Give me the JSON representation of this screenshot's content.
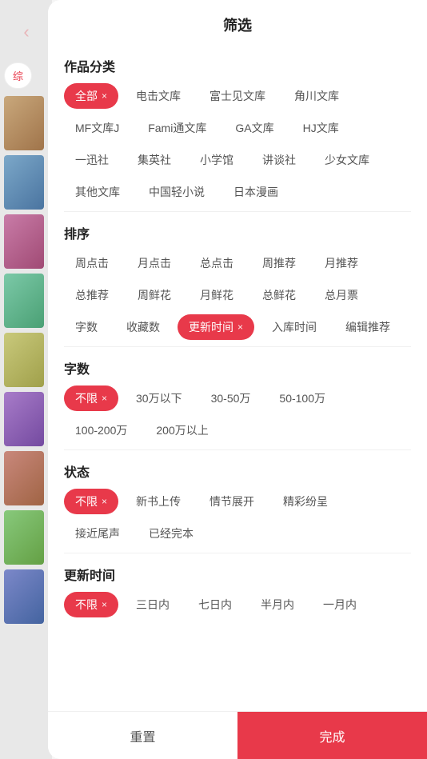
{
  "header": {
    "title": "筛选",
    "back_icon": "‹"
  },
  "sidebar": {
    "tab_label": "综"
  },
  "sections": {
    "category": {
      "title": "作品分类",
      "tags": [
        {
          "label": "全部",
          "active": true
        },
        {
          "label": "电击文库",
          "active": false
        },
        {
          "label": "富士见文库",
          "active": false
        },
        {
          "label": "角川文库",
          "active": false
        },
        {
          "label": "MF文库J",
          "active": false
        },
        {
          "label": "Fami通文库",
          "active": false
        },
        {
          "label": "GA文库",
          "active": false
        },
        {
          "label": "HJ文库",
          "active": false
        },
        {
          "label": "一迅社",
          "active": false
        },
        {
          "label": "集英社",
          "active": false
        },
        {
          "label": "小学馆",
          "active": false
        },
        {
          "label": "讲谈社",
          "active": false
        },
        {
          "label": "少女文库",
          "active": false
        },
        {
          "label": "其他文库",
          "active": false
        },
        {
          "label": "中国轻小说",
          "active": false
        },
        {
          "label": "日本漫画",
          "active": false
        }
      ]
    },
    "sort": {
      "title": "排序",
      "tags": [
        {
          "label": "周点击",
          "active": false
        },
        {
          "label": "月点击",
          "active": false
        },
        {
          "label": "总点击",
          "active": false
        },
        {
          "label": "周推荐",
          "active": false
        },
        {
          "label": "月推荐",
          "active": false
        },
        {
          "label": "总推荐",
          "active": false
        },
        {
          "label": "周鲜花",
          "active": false
        },
        {
          "label": "月鲜花",
          "active": false
        },
        {
          "label": "总鲜花",
          "active": false
        },
        {
          "label": "总月票",
          "active": false
        },
        {
          "label": "字数",
          "active": false
        },
        {
          "label": "收藏数",
          "active": false
        },
        {
          "label": "更新时间",
          "active": true
        },
        {
          "label": "入库时间",
          "active": false
        },
        {
          "label": "编辑推荐",
          "active": false
        }
      ]
    },
    "word_count": {
      "title": "字数",
      "tags": [
        {
          "label": "不限",
          "active": true
        },
        {
          "label": "30万以下",
          "active": false
        },
        {
          "label": "30-50万",
          "active": false
        },
        {
          "label": "50-100万",
          "active": false
        },
        {
          "label": "100-200万",
          "active": false
        },
        {
          "label": "200万以上",
          "active": false
        }
      ]
    },
    "status": {
      "title": "状态",
      "tags": [
        {
          "label": "不限",
          "active": true
        },
        {
          "label": "新书上传",
          "active": false
        },
        {
          "label": "情节展开",
          "active": false
        },
        {
          "label": "精彩纷呈",
          "active": false
        },
        {
          "label": "接近尾声",
          "active": false
        },
        {
          "label": "已经完本",
          "active": false
        }
      ]
    },
    "update_time": {
      "title": "更新时间",
      "tags": [
        {
          "label": "不限",
          "active": true
        },
        {
          "label": "三日内",
          "active": false
        },
        {
          "label": "七日内",
          "active": false
        },
        {
          "label": "半月内",
          "active": false
        },
        {
          "label": "一月内",
          "active": false
        }
      ]
    }
  },
  "footer": {
    "reset_label": "重置",
    "confirm_label": "完成"
  }
}
